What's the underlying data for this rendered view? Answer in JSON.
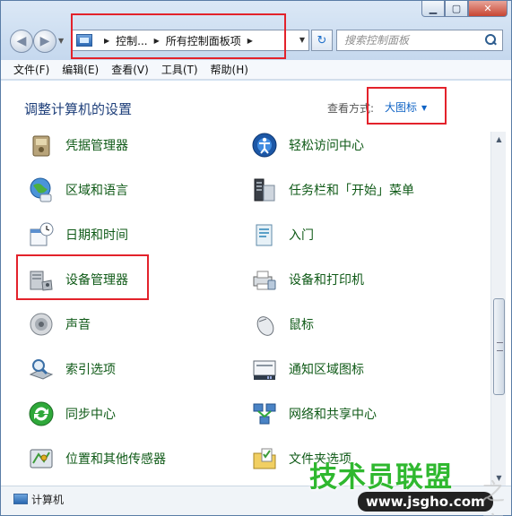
{
  "address_bar": {
    "crumbs": [
      "控制...",
      "所有控制面板项"
    ]
  },
  "search": {
    "placeholder": "搜索控制面板"
  },
  "menubar": [
    "文件(F)",
    "编辑(E)",
    "查看(V)",
    "工具(T)",
    "帮助(H)"
  ],
  "header": {
    "title": "调整计算机的设置",
    "view_label": "查看方式:",
    "view_value": "大图标"
  },
  "items": [
    {
      "label": "凭据管理器",
      "icon": "vault-icon"
    },
    {
      "label": "轻松访问中心",
      "icon": "accessibility-icon"
    },
    {
      "label": "区域和语言",
      "icon": "globe-clock-icon"
    },
    {
      "label": "任务栏和「开始」菜单",
      "icon": "taskbar-icon"
    },
    {
      "label": "日期和时间",
      "icon": "calendar-clock-icon"
    },
    {
      "label": "入门",
      "icon": "getting-started-icon"
    },
    {
      "label": "设备管理器",
      "icon": "device-manager-icon"
    },
    {
      "label": "设备和打印机",
      "icon": "printer-icon"
    },
    {
      "label": "声音",
      "icon": "speaker-icon"
    },
    {
      "label": "鼠标",
      "icon": "mouse-icon"
    },
    {
      "label": "索引选项",
      "icon": "indexing-icon"
    },
    {
      "label": "通知区域图标",
      "icon": "notification-area-icon"
    },
    {
      "label": "同步中心",
      "icon": "sync-icon"
    },
    {
      "label": "网络和共享中心",
      "icon": "network-icon"
    },
    {
      "label": "位置和其他传感器",
      "icon": "location-sensor-icon"
    },
    {
      "label": "文件夹选项",
      "icon": "folder-options-icon"
    }
  ],
  "statusbar": {
    "text": "计算机"
  },
  "watermark": {
    "main": "技术员联盟",
    "url": "www.jsgho.com",
    "ghost": "之家"
  }
}
